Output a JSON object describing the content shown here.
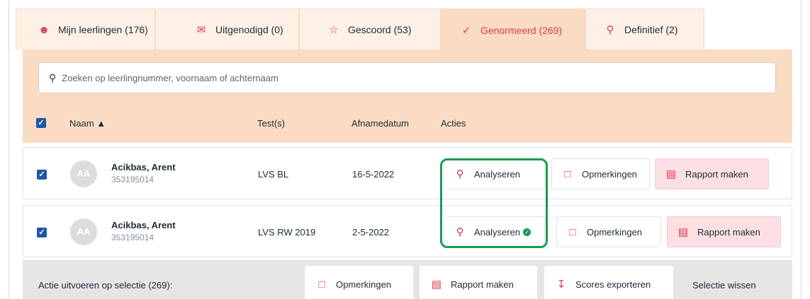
{
  "tabs": [
    {
      "label": "Mijn leerlingen (176)",
      "icon": "users-icon",
      "active": false
    },
    {
      "label": "Uitgenodigd (0)",
      "icon": "envelope-icon",
      "active": false
    },
    {
      "label": "Gescoord (53)",
      "icon": "star-icon",
      "active": false
    },
    {
      "label": "Genormeerd (269)",
      "icon": "check-circle-icon",
      "active": true
    },
    {
      "label": "Definitief (2)",
      "icon": "award-icon",
      "active": false
    }
  ],
  "search": {
    "placeholder": "Zoeken op leerlingnummer, voornaam of achternaam"
  },
  "table": {
    "headers": {
      "name": "Naam ▲",
      "tests": "Test(s)",
      "date": "Afnamedatum",
      "actions": "Acties"
    },
    "rows": [
      {
        "initials": "AA",
        "name": "Acikbas, Arent",
        "number": "353195014",
        "test": "LVS BL",
        "date": "16-5-2022",
        "analysed": false
      },
      {
        "initials": "AA",
        "name": "Acikbas, Arent",
        "number": "353195014",
        "test": "LVS RW 2019",
        "date": "2-5-2022",
        "analysed": true
      }
    ]
  },
  "actions": {
    "analyse": "Analyseren",
    "remarks": "Opmerkingen",
    "report": "Rapport maken"
  },
  "bottom": {
    "label": "Actie uitvoeren op selectie (269):",
    "remarks": "Opmerkingen",
    "report": "Rapport maken",
    "export": "Scores exporteren",
    "clear": "Selectie wissen"
  },
  "colors": {
    "accent": "#e0364f",
    "tab_bg": "#fdf1e6",
    "panel_bg": "#f9dcc2",
    "highlight": "#1a9b55",
    "checkbox": "#1f57a8"
  }
}
